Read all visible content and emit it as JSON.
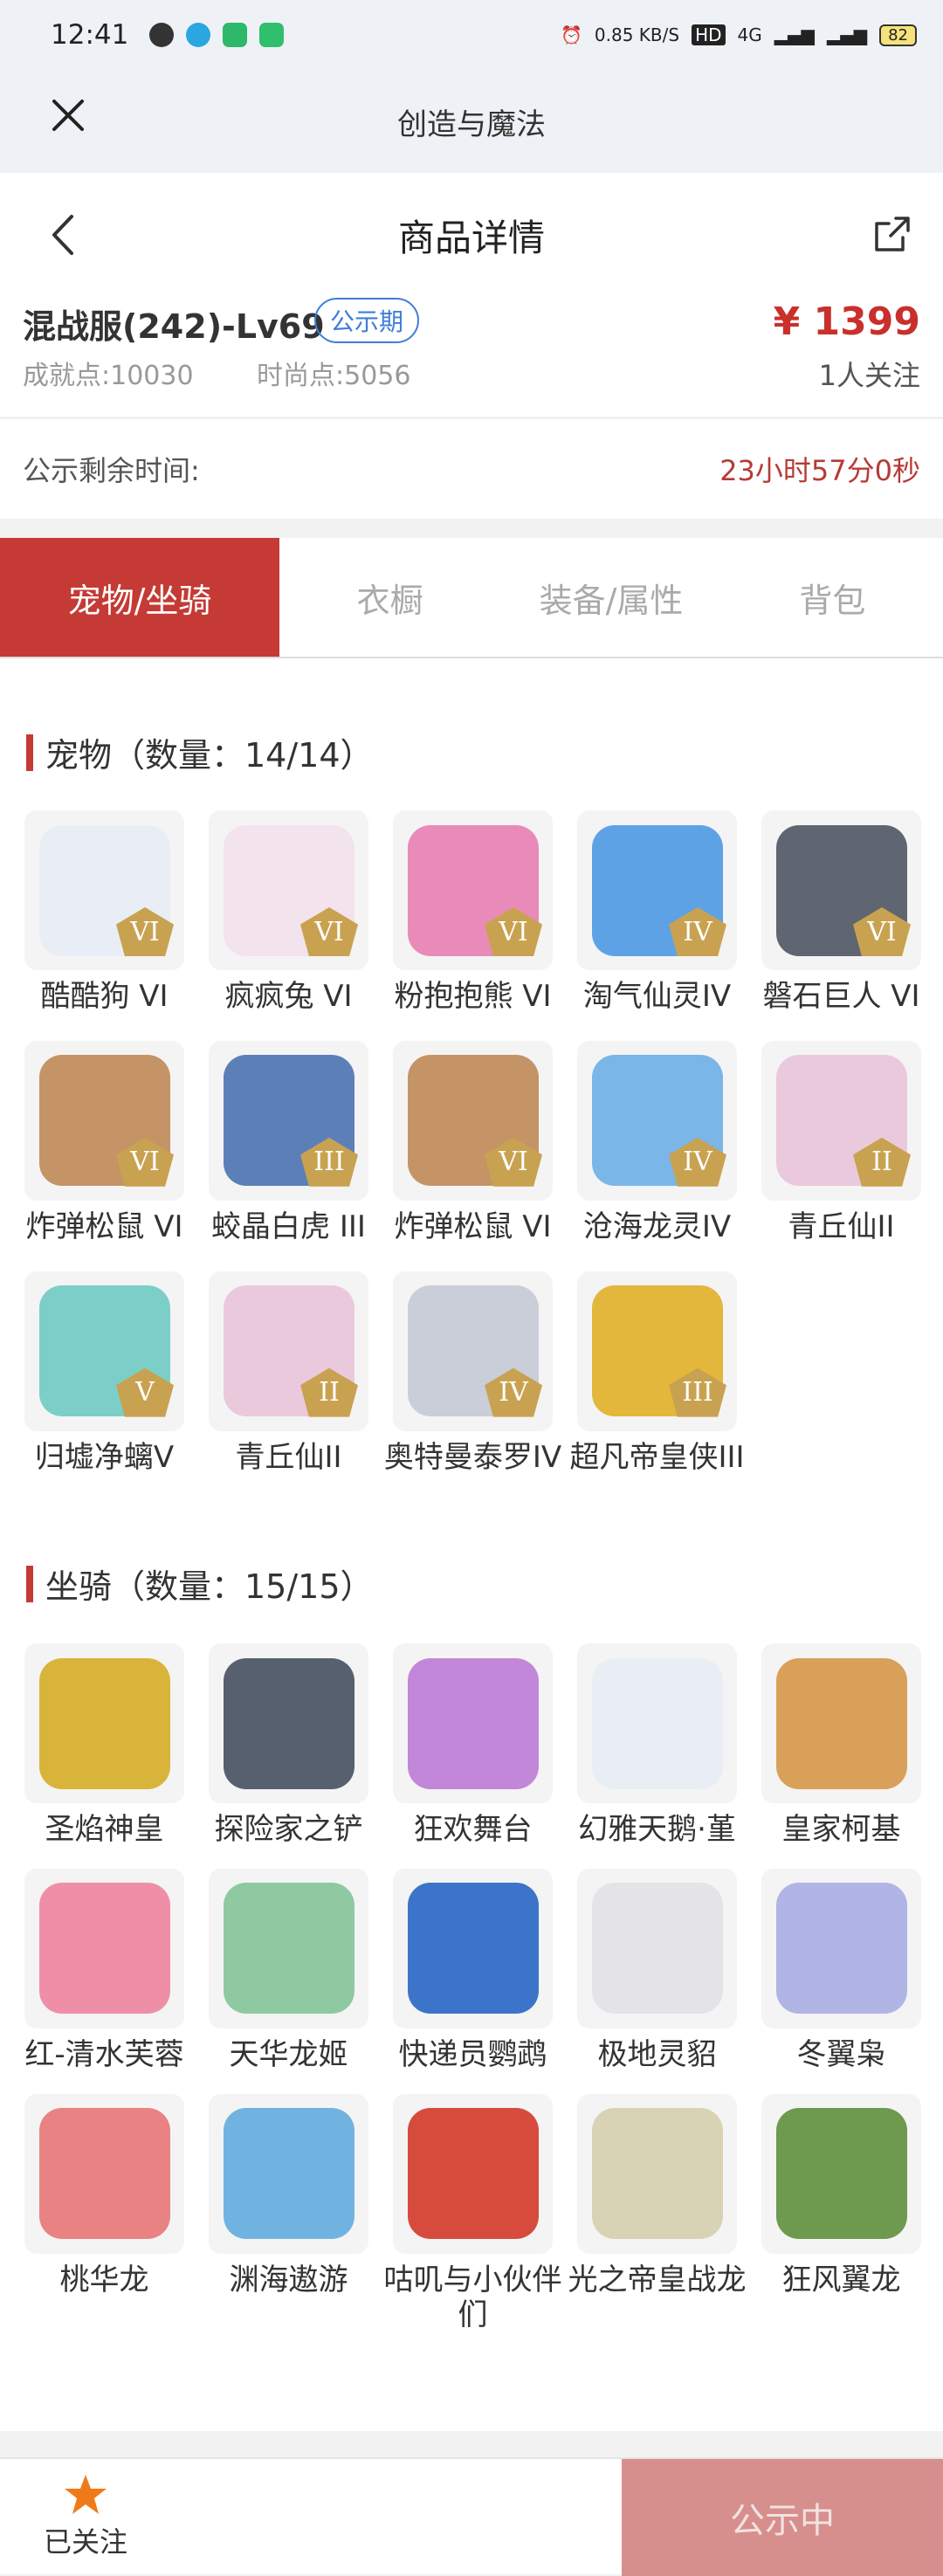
{
  "status_bar": {
    "time": "12:41",
    "speed": "0.85 KB/S",
    "network": "4G",
    "battery": "82"
  },
  "app_title": "创造与魔法",
  "nav": {
    "title": "商品详情"
  },
  "product": {
    "name": "混战服(242)-Lv69",
    "badge": "公示期",
    "achievement_label": "成就点:",
    "achievement_value": "10030",
    "fashion_label": "时尚点:",
    "fashion_value": "5056",
    "price": "¥ 1399",
    "followers": "1人关注"
  },
  "notice": {
    "label": "公示剩余时间:",
    "remaining": "23小时57分0秒"
  },
  "tabs": [
    "宠物/坐骑",
    "衣橱",
    "装备/属性",
    "背包"
  ],
  "pets": {
    "title": "宠物（数量：14/14）",
    "items": [
      {
        "name": "酷酷狗 VI",
        "level": "VI",
        "color": "#e9eef6"
      },
      {
        "name": "疯疯兔 VI",
        "level": "VI",
        "color": "#f3e3ec"
      },
      {
        "name": "粉抱抱熊 VI",
        "level": "VI",
        "color": "#e98bb8"
      },
      {
        "name": "淘气仙灵IV",
        "level": "IV",
        "color": "#5ea2e6"
      },
      {
        "name": "磐石巨人 VI",
        "level": "VI",
        "color": "#5f6671"
      },
      {
        "name": "炸弹松鼠 VI",
        "level": "VI",
        "color": "#c49467"
      },
      {
        "name": "蛟晶白虎 III",
        "level": "III",
        "color": "#5c7fb8"
      },
      {
        "name": "炸弹松鼠 VI",
        "level": "VI",
        "color": "#c49467"
      },
      {
        "name": "沧海龙灵IV",
        "level": "IV",
        "color": "#7ab6e8"
      },
      {
        "name": "青丘仙II",
        "level": "II",
        "color": "#ebc9dc"
      },
      {
        "name": "归墟净螭V",
        "level": "V",
        "color": "#7ccfc8"
      },
      {
        "name": "青丘仙II",
        "level": "II",
        "color": "#ebc9dc"
      },
      {
        "name": "奥特曼泰罗IV",
        "level": "IV",
        "color": "#c9ced8"
      },
      {
        "name": "超凡帝皇侠III",
        "level": "III",
        "color": "#e3b63c"
      }
    ]
  },
  "mounts": {
    "title": "坐骑（数量：15/15）",
    "items": [
      {
        "name": "圣焰神皇",
        "color": "#d9b43b"
      },
      {
        "name": "探险家之铲",
        "color": "#56606e"
      },
      {
        "name": "狂欢舞台",
        "color": "#c287d9"
      },
      {
        "name": "幻雅天鹅·堇",
        "color": "#e9eef4"
      },
      {
        "name": "皇家柯基",
        "color": "#d9a05a"
      },
      {
        "name": "红-清水芙蓉",
        "color": "#ef8fa7"
      },
      {
        "name": "天华龙姬",
        "color": "#8ec9a2"
      },
      {
        "name": "快递员鹦鹉",
        "color": "#3c74c9"
      },
      {
        "name": "极地灵貂",
        "color": "#e4e4e8"
      },
      {
        "name": "冬翼枭",
        "color": "#b0b5e6"
      },
      {
        "name": "桃华龙",
        "color": "#e98383"
      },
      {
        "name": "渊海遨游",
        "color": "#71b3e0"
      },
      {
        "name": "咕叽与小伙伴们",
        "color": "#d64b3c"
      },
      {
        "name": "光之帝皇战龙",
        "color": "#d8d3b5"
      },
      {
        "name": "狂风翼龙",
        "color": "#6d9a4e"
      }
    ]
  },
  "bottom": {
    "follow_label": "已关注",
    "status_button": "公示中"
  }
}
